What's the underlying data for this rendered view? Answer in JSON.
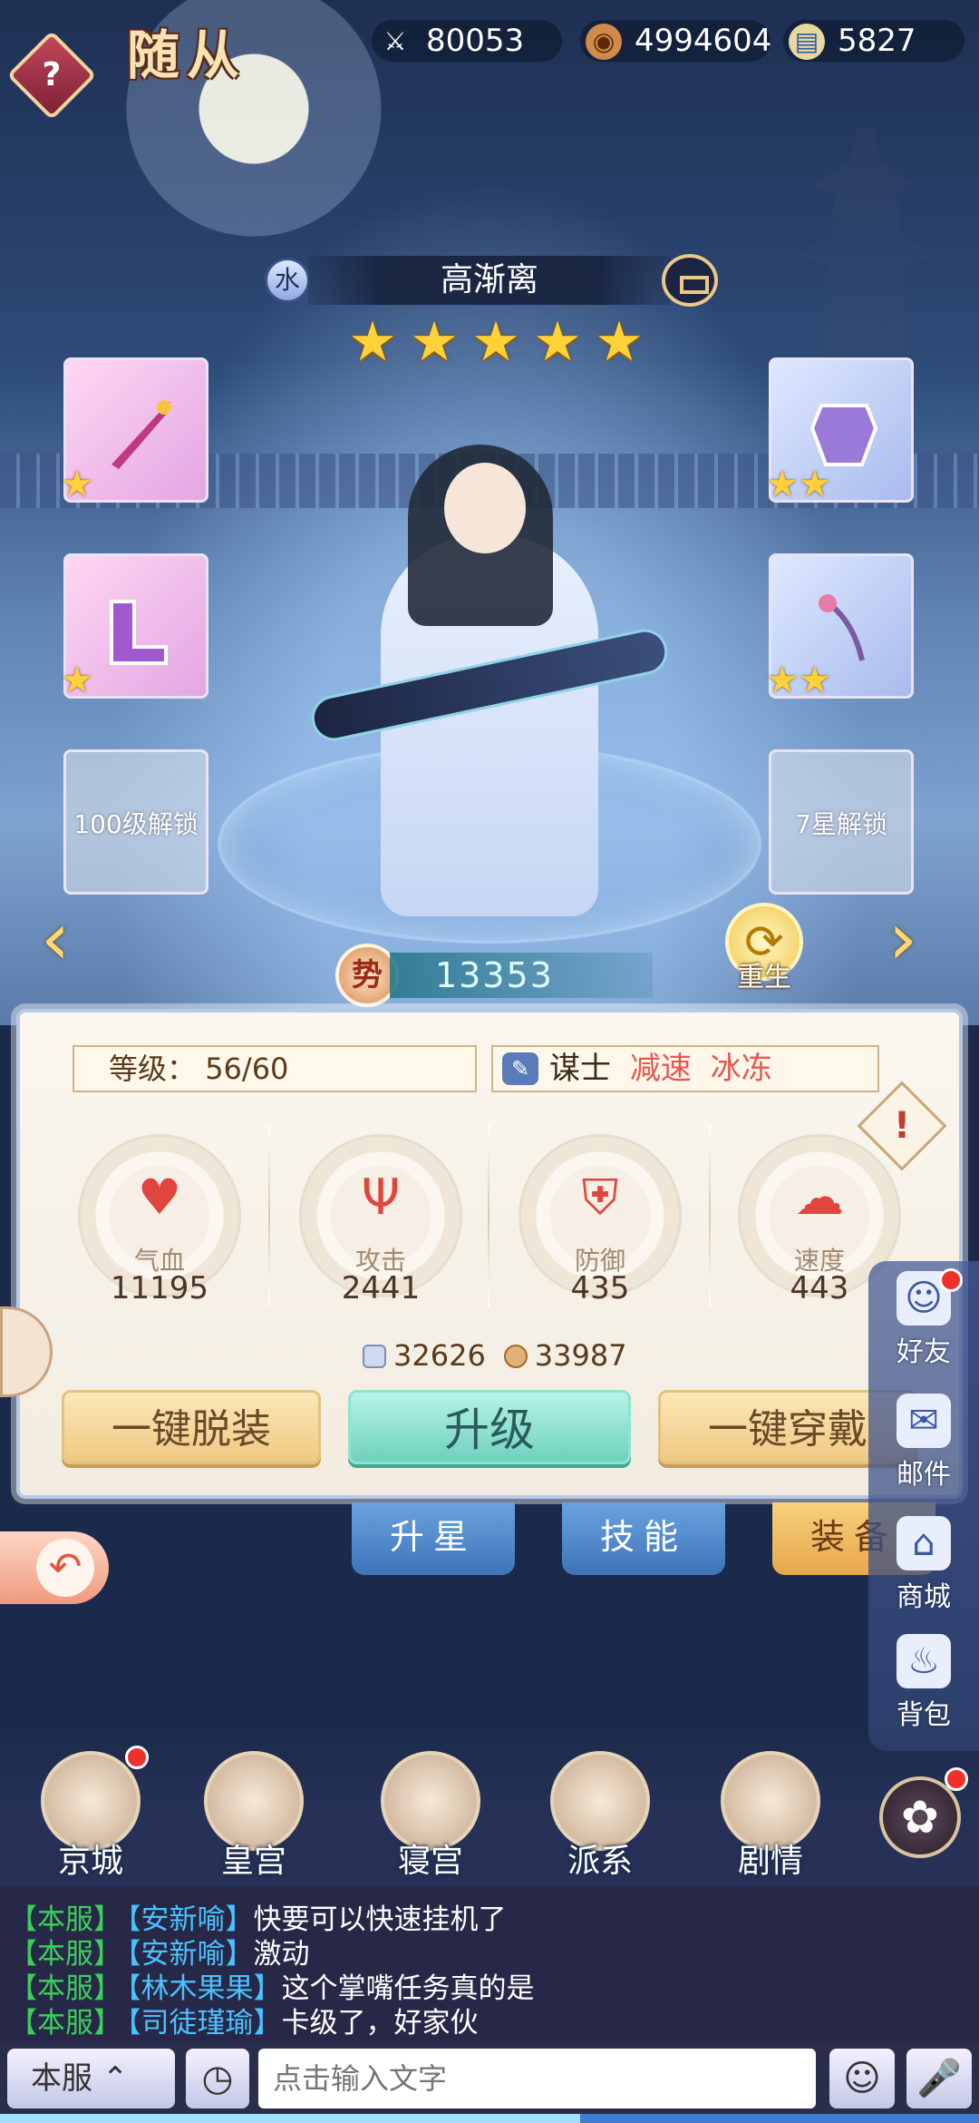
{
  "header": {
    "help_icon": "?",
    "title": "随从",
    "resources": [
      {
        "icon": "crossed-swords-icon",
        "value": "80053"
      },
      {
        "icon": "copper-coin-icon",
        "value": "4994604"
      },
      {
        "icon": "scroll-book-icon",
        "value": "5827"
      }
    ]
  },
  "hero": {
    "element": "水",
    "name": "高渐离",
    "stars": 5,
    "power": "13353",
    "power_icon": "势",
    "rebirth_label": "重生"
  },
  "slots": {
    "slot_5_lock": "100级解锁",
    "slot_6_lock": "7星解锁"
  },
  "panel": {
    "level_label": "等级：",
    "level_value": "56/60",
    "class_name": "谋士",
    "class_tags": [
      "减速",
      "冰冻"
    ],
    "stats": [
      {
        "label": "气血",
        "value": "11195",
        "icon": "heart-icon",
        "color": "#e0463e"
      },
      {
        "label": "攻击",
        "value": "2441",
        "icon": "trident-icon",
        "color": "#e0463e"
      },
      {
        "label": "防御",
        "value": "435",
        "icon": "shield-icon",
        "color": "#e0463e"
      },
      {
        "label": "速度",
        "value": "443",
        "icon": "cloud-icon",
        "color": "#e0463e"
      }
    ],
    "exp_scroll": "32626",
    "exp_coin": "33987",
    "buttons": {
      "unequip": "一键脱装",
      "upgrade": "升级",
      "equip": "一键穿戴"
    }
  },
  "tabs": [
    "升星",
    "技能",
    "装备"
  ],
  "side_menu": [
    "好友",
    "邮件",
    "商城",
    "背包"
  ],
  "bottom_nav": [
    "京城",
    "皇宫",
    "寝宫",
    "派系",
    "剧情"
  ],
  "chat": {
    "messages": [
      {
        "channel": "【本服】",
        "user": "【安新喻】",
        "text": "快要可以快速挂机了"
      },
      {
        "channel": "【本服】",
        "user": "【安新喻】",
        "text": "激动"
      },
      {
        "channel": "【本服】",
        "user": "【林木果果】",
        "text": "这个掌嘴任务真的是"
      },
      {
        "channel": "【本服】",
        "user": "【司徒瑾瑜】",
        "text": "卡级了，好家伙"
      }
    ],
    "server_button": "本服",
    "input_placeholder": "点击输入文字"
  },
  "colors": {
    "accent_gold": "#ffd23a",
    "tag_red": "#e4584f",
    "chat_channel": "#3ccf5a",
    "chat_user": "#4bc2ff"
  }
}
